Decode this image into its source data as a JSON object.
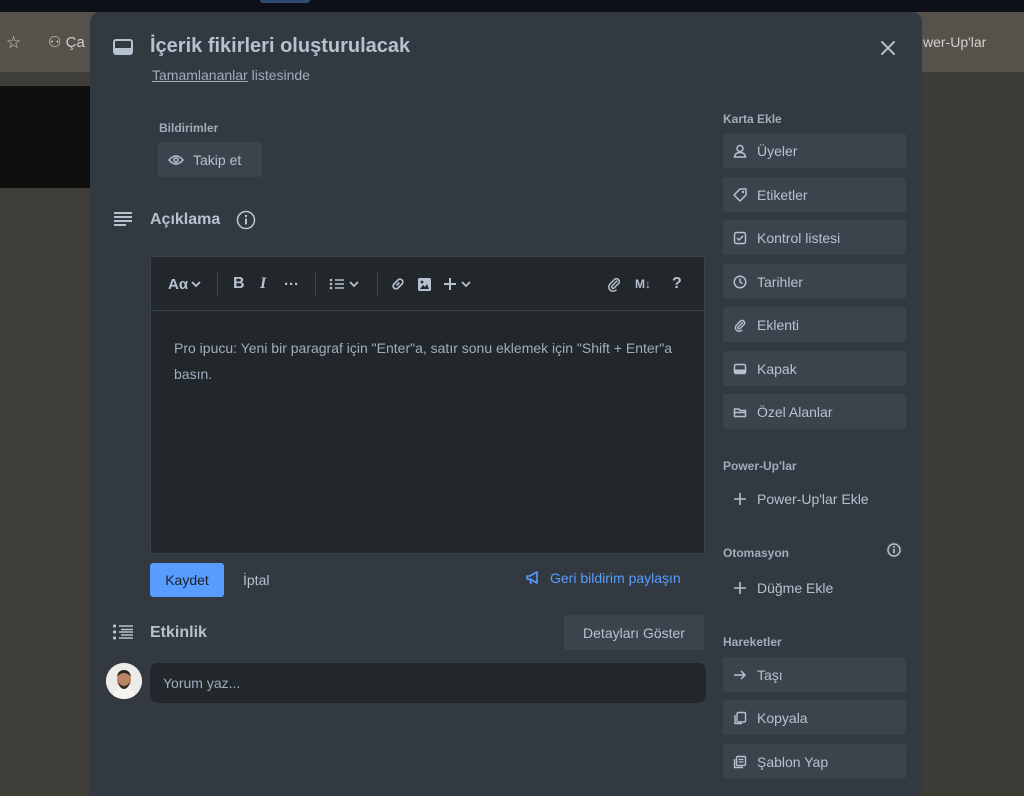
{
  "background": {
    "board_right_label": "wer-Up'lar",
    "board_left_label": "Ça"
  },
  "card": {
    "title": "İçerik fikirleri oluşturulacak",
    "list_name": "Tamamlananlar",
    "list_suffix": " listesinde"
  },
  "notifications": {
    "title": "Bildirimler",
    "watch_label": "Takip et"
  },
  "description": {
    "title": "Açıklama",
    "hint": "Pro ipucu: Yeni bir paragraf için \"Enter\"a, satır sonu eklemek için \"Shift + Enter\"a basın.",
    "toolbar": {
      "text_style": "Aα",
      "bold": "B",
      "italic": "I",
      "more": "···",
      "markdown": "M↓",
      "help": "?"
    },
    "save_label": "Kaydet",
    "cancel_label": "İptal",
    "feedback_label": "Geri bildirim paylaşın"
  },
  "activity": {
    "title": "Etkinlik",
    "details_label": "Detayları Göster",
    "comment_placeholder": "Yorum yaz..."
  },
  "sidebar": {
    "add_to_card_title": "Karta Ekle",
    "add_to_card": [
      {
        "label": "Üyeler",
        "icon": "person-icon"
      },
      {
        "label": "Etiketler",
        "icon": "tag-icon"
      },
      {
        "label": "Kontrol listesi",
        "icon": "checkbox-icon"
      },
      {
        "label": "Tarihler",
        "icon": "clock-icon"
      },
      {
        "label": "Eklenti",
        "icon": "paperclip-icon"
      },
      {
        "label": "Kapak",
        "icon": "card-cover-icon"
      },
      {
        "label": "Özel Alanlar",
        "icon": "custom-field-icon"
      }
    ],
    "powerups_title": "Power-Up'lar",
    "powerups_add": "Power-Up'lar Ekle",
    "automation_title": "Otomasyon",
    "automation_add": "Düğme Ekle",
    "actions_title": "Hareketler",
    "actions": [
      {
        "label": "Taşı",
        "icon": "arrow-right-icon"
      },
      {
        "label": "Kopyala",
        "icon": "copy-icon"
      },
      {
        "label": "Şablon Yap",
        "icon": "template-icon"
      }
    ]
  },
  "colors": {
    "modal_bg": "#323940",
    "button_bg": "#3b444c",
    "editor_bg": "#22272b",
    "accent": "#579dff",
    "text": "#b6c2cf",
    "muted": "#9fadbc"
  }
}
